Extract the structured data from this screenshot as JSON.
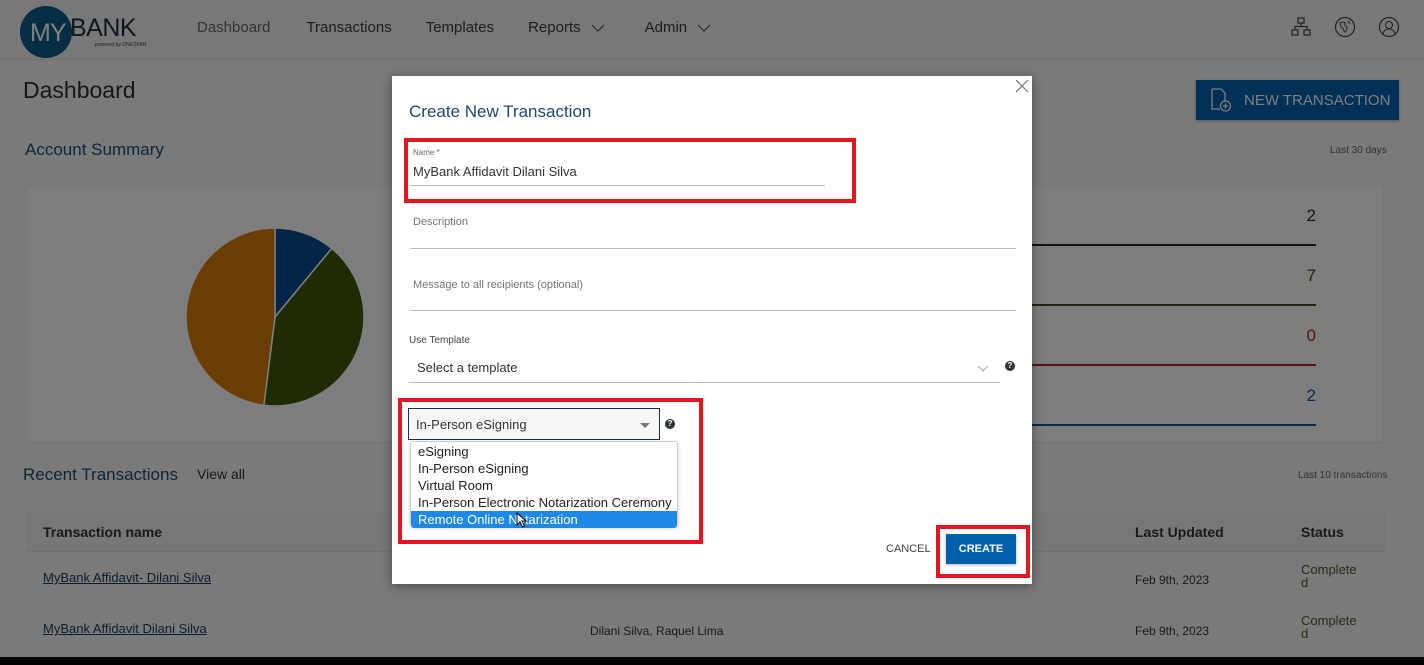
{
  "header": {
    "logo_my": "MY",
    "logo_bank": "BANK",
    "logo_powered": "powered by ONESPAN",
    "nav": [
      {
        "label": "Dashboard",
        "has_dropdown": false
      },
      {
        "label": "Transactions",
        "has_dropdown": false
      },
      {
        "label": "Templates",
        "has_dropdown": false
      },
      {
        "label": "Reports",
        "has_dropdown": true
      },
      {
        "label": "Admin",
        "has_dropdown": true
      }
    ],
    "icons": [
      "org-chart-icon",
      "globe-icon",
      "user-profile-icon"
    ]
  },
  "page": {
    "title": "Dashboard",
    "new_transaction_label": "NEW TRANSACTION"
  },
  "account_summary": {
    "title": "Account Summary",
    "period": "Last 30 days",
    "stats": [
      {
        "value": "2",
        "color": "#1f2a33"
      },
      {
        "value": "7",
        "color": "#3c4a1a"
      },
      {
        "value": "0",
        "color": "#b3261e"
      },
      {
        "value": "2",
        "color": "#0b5a9a"
      }
    ]
  },
  "chart_data": {
    "type": "pie",
    "title": "",
    "slices": [
      {
        "name": "blue",
        "share_percent": 11,
        "color": "#014b8f"
      },
      {
        "name": "green",
        "share_percent": 41,
        "color": "#3f5708"
      },
      {
        "name": "orange",
        "share_percent": 48,
        "color": "#d87a05"
      }
    ],
    "start_angle_deg": 0,
    "legend": "none"
  },
  "recent": {
    "title": "Recent Transactions",
    "view_all": "View all",
    "period": "Last 10 transactions",
    "columns": [
      "Transaction name",
      "Last Updated",
      "Status"
    ],
    "rows": [
      {
        "name": "MyBank Affidavit- Dilani Silva",
        "recipients": "",
        "updated": "Feb 9th, 2023",
        "status": "Completed"
      },
      {
        "name": "MyBank Affidavit Dilani Silva",
        "recipients": "Dilani Silva, Raquel Lima",
        "updated": "Feb 9th, 2023",
        "status": "Completed"
      }
    ]
  },
  "modal": {
    "title": "Create New Transaction",
    "name_label": "Name *",
    "name_value": "MyBank Affidavit Dilani Silva",
    "description_placeholder": "Description",
    "message_placeholder": "Message to all recipients (optional)",
    "template_label": "Use Template",
    "template_value": "Select a template",
    "type_value": "In-Person eSigning",
    "type_options": [
      "eSigning",
      "In-Person eSigning",
      "Virtual Room",
      "In-Person Electronic Notarization Ceremony",
      "Remote Online Notarization"
    ],
    "type_highlighted_index": 4,
    "help_glyph": "?",
    "cancel_label": "CANCEL",
    "create_label": "CREATE"
  }
}
